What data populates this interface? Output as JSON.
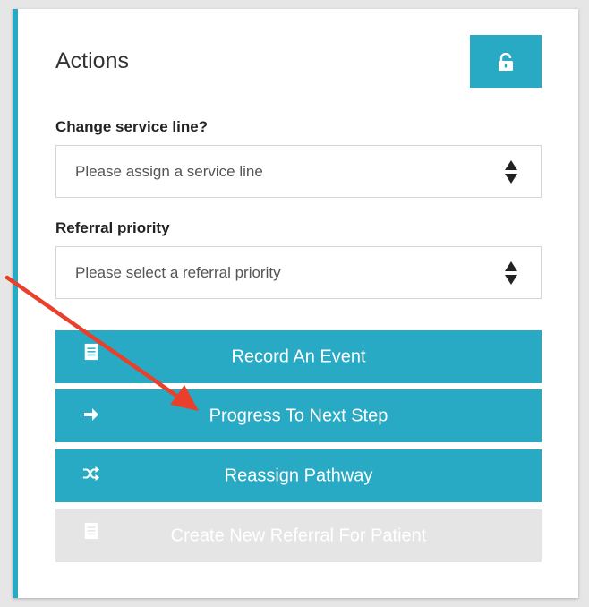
{
  "panel": {
    "title": "Actions",
    "lock_icon": "lock-icon"
  },
  "service_line": {
    "label": "Change service line?",
    "value": "Please assign a service line"
  },
  "referral_priority": {
    "label": "Referral priority",
    "value": "Please select a referral priority"
  },
  "actions": [
    {
      "label": "Record An Event",
      "icon": "document-icon",
      "enabled": true
    },
    {
      "label": "Progress To Next Step",
      "icon": "arrow-right-icon",
      "enabled": true
    },
    {
      "label": "Reassign Pathway",
      "icon": "shuffle-icon",
      "enabled": true
    },
    {
      "label": "Create New Referral For Patient",
      "icon": "document-icon",
      "enabled": false
    }
  ],
  "colors": {
    "accent": "#29aac4",
    "disabled": "#e5e5e5",
    "annotation_arrow": "#e8402a"
  }
}
